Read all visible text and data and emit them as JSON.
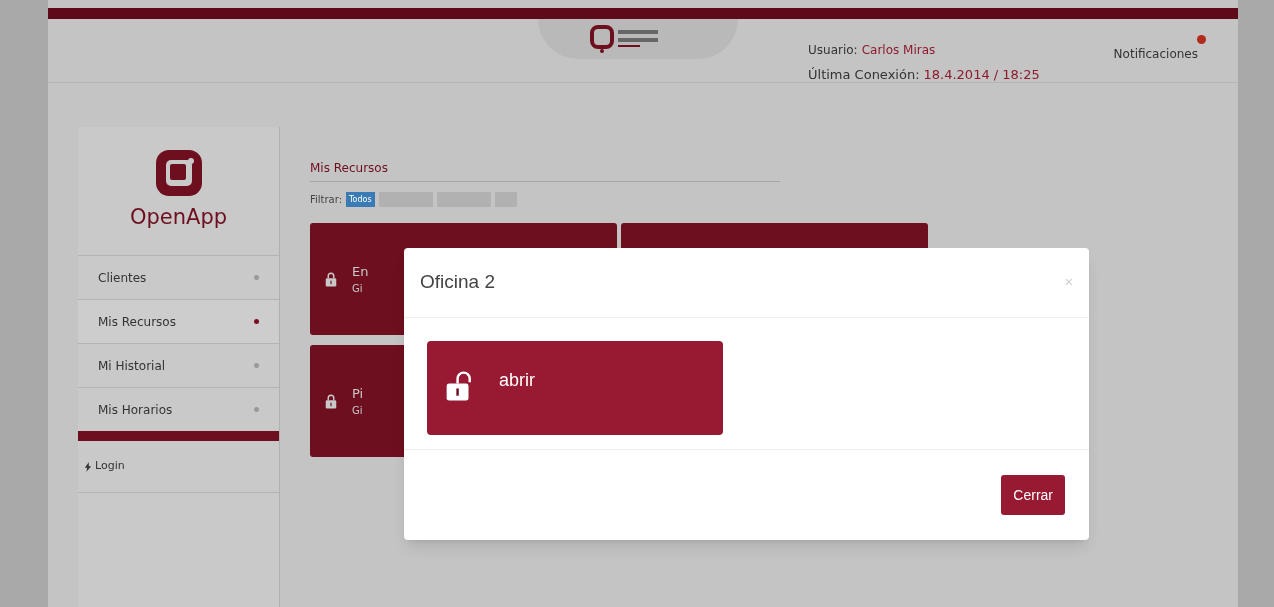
{
  "header": {
    "user_label": "Usuario:",
    "user_name": "Carlos Miras",
    "notifications": "Notificaciones",
    "has_notifications": true,
    "last_label": "Última Conexión:",
    "last_value": "18.4.2014 / 18:25"
  },
  "sidebar": {
    "app_name": "OpenApp",
    "items": [
      {
        "label": "Clientes",
        "selected": false
      },
      {
        "label": "Mis Recursos",
        "selected": true
      },
      {
        "label": "Mi Historial",
        "selected": false
      },
      {
        "label": "Mis Horarios",
        "selected": false
      }
    ],
    "login": "Login"
  },
  "content": {
    "title": "Mis Recursos",
    "filter_label": "Filtrar:",
    "filters": [
      {
        "label": "Todos",
        "selected": true
      },
      {
        "selected": false
      },
      {
        "selected": false
      },
      {
        "selected": false
      }
    ],
    "cards": [
      {
        "kind": "resource",
        "title": "En",
        "subtitle": "Gi",
        "locked": true
      },
      {
        "kind": "covered"
      },
      {
        "kind": "resource",
        "title": "Pi",
        "subtitle": "Gi",
        "locked": true
      }
    ]
  },
  "modal": {
    "title": "Oficina 2",
    "close": "×",
    "action": {
      "label": "abrir",
      "locked": false
    },
    "button": "Cerrar"
  }
}
